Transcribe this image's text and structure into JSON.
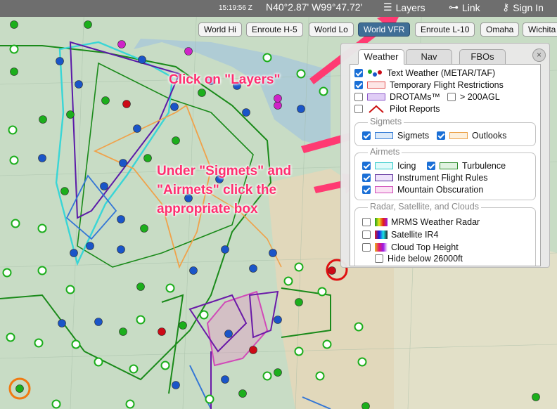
{
  "topbar": {
    "time": "15:19:56 Z",
    "coords": "N40°2.87' W99°47.72'",
    "layers_label": "Layers",
    "link_label": "Link",
    "signin_label": "Sign In"
  },
  "charts": [
    "World Hi",
    "Enroute H-5",
    "World Lo",
    "World VFR",
    "Enroute L-10",
    "Omaha",
    "Wichita"
  ],
  "panel": {
    "tabs": [
      "Weather",
      "Nav",
      "FBOs"
    ],
    "close_symbol": "×",
    "items": {
      "text_weather": {
        "label": "Text Weather (METAR/TAF)",
        "checked": true
      },
      "tfr": {
        "label": "Temporary Flight Restrictions",
        "checked": true
      },
      "drotams": {
        "label": "DROTAMs™",
        "checked": false,
        "extra_label": "> 200AGL",
        "extra_checked": false
      },
      "pireps": {
        "label": "Pilot Reports",
        "checked": false
      }
    },
    "sigmets": {
      "title": "Sigmets",
      "sigmets": {
        "label": "Sigmets",
        "checked": true
      },
      "outlooks": {
        "label": "Outlooks",
        "checked": true
      }
    },
    "airmets": {
      "title": "Airmets",
      "icing": {
        "label": "Icing",
        "checked": true
      },
      "turbulence": {
        "label": "Turbulence",
        "checked": true
      },
      "ifr": {
        "label": "Instrument Flight Rules",
        "checked": true
      },
      "mtn": {
        "label": "Mountain Obscuration",
        "checked": true
      }
    },
    "radar": {
      "title": "Radar, Satellite, and Clouds",
      "mrms": {
        "label": "MRMS Weather Radar",
        "checked": false
      },
      "ir4": {
        "label": "Satellite IR4",
        "checked": false
      },
      "cloudtop": {
        "label": "Cloud Top Height",
        "checked": false
      },
      "hide": {
        "label": "Hide below 26000ft",
        "checked": false
      }
    }
  },
  "annotations": {
    "layers": "Click on \"Layers\"",
    "line1": "Under \"Sigmets\" and",
    "line2": "\"Airmets\" click the",
    "line3": "appropriate box"
  },
  "colors": {
    "annotation": "#ff2d6f",
    "vfr_green": "#1cae1c",
    "ifr_red": "#cc0a16",
    "mvfr_blue": "#1a55c8",
    "lifr_magenta": "#cf23c8",
    "active_chart": "#3f6e96"
  }
}
